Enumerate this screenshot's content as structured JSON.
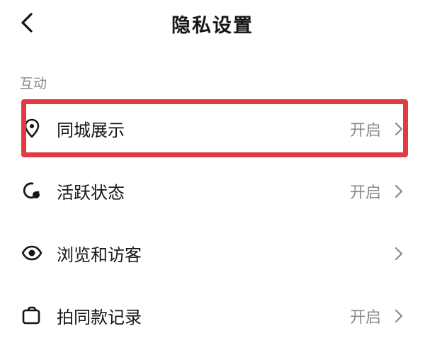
{
  "header": {
    "title": "隐私设置",
    "back_icon": "chevron-left-icon"
  },
  "sections": [
    {
      "label": "互动",
      "items": [
        {
          "label": "同城展示",
          "value": "开启",
          "icon": "location-pin-icon"
        },
        {
          "label": "活跃状态",
          "value": "开启",
          "icon": "active-status-icon"
        },
        {
          "label": "浏览和访客",
          "value": "",
          "icon": "eye-icon"
        },
        {
          "label": "拍同款记录",
          "value": "开启",
          "icon": "camera-icon"
        }
      ]
    }
  ],
  "highlight_color": "#e23a45"
}
